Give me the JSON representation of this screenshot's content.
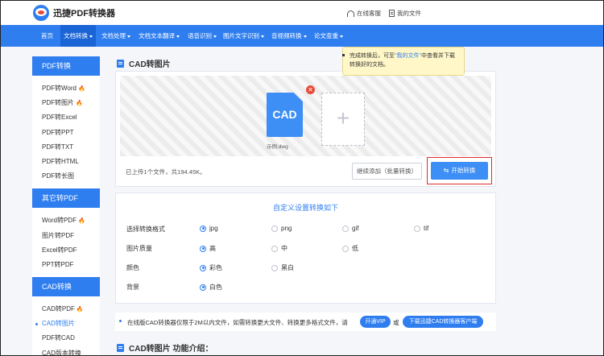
{
  "header": {
    "logo_text": "迅捷PDF转换器",
    "service_label": "在线客服",
    "my_files_label": "我的文件"
  },
  "nav": {
    "items": [
      {
        "label": "首页",
        "dropdown": false
      },
      {
        "label": "文档转换",
        "dropdown": true,
        "active": true
      },
      {
        "label": "文档处理",
        "dropdown": true
      },
      {
        "label": "文档文本翻译",
        "dropdown": true
      },
      {
        "label": "语音识别",
        "dropdown": true
      },
      {
        "label": "图片文字识别",
        "dropdown": true
      },
      {
        "label": "音视频转换",
        "dropdown": true
      },
      {
        "label": "论文查重",
        "dropdown": true
      }
    ]
  },
  "tooltip": {
    "part1": "完成转换后，可至",
    "link": "\"我的文件\"",
    "part2": "中查看并下载转换好的文档。"
  },
  "sidebar": {
    "groups": [
      {
        "title": "PDF转换",
        "items": [
          {
            "label": "PDF转Word",
            "hot": true
          },
          {
            "label": "PDF转图片",
            "hot": true
          },
          {
            "label": "PDF转Excel"
          },
          {
            "label": "PDF转PPT"
          },
          {
            "label": "PDF转TXT"
          },
          {
            "label": "PDF转HTML"
          },
          {
            "label": "PDF转长图"
          }
        ]
      },
      {
        "title": "其它转PDF",
        "items": [
          {
            "label": "Word转PDF",
            "hot": true
          },
          {
            "label": "图片转PDF"
          },
          {
            "label": "Excel转PDF"
          },
          {
            "label": "PPT转PDF"
          }
        ]
      },
      {
        "title": "CAD转换",
        "items": [
          {
            "label": "CAD转PDF",
            "hot": true
          },
          {
            "label": "CAD转图片",
            "active": true
          },
          {
            "label": "PDF转CAD"
          },
          {
            "label": "CAD版本转换"
          }
        ]
      }
    ]
  },
  "main": {
    "page_title": "CAD转图片",
    "file": {
      "thumb_text": "CAD",
      "name": "示例.dwg",
      "remove_glyph": "✕"
    },
    "add_glyph": "+",
    "upload_status": "已上传1个文件，共194.45K。",
    "continue_button": "继续添加（批量转换）",
    "start_button": "开始转换",
    "start_glyph": "⇆"
  },
  "settings": {
    "title": "自定义设置转换如下",
    "rows": [
      {
        "label": "选择转换格式",
        "options": [
          {
            "label": "jpg",
            "selected": true
          },
          {
            "label": "png"
          },
          {
            "label": "gif"
          },
          {
            "label": "tif"
          }
        ]
      },
      {
        "label": "图片质量",
        "options": [
          {
            "label": "高",
            "selected": true
          },
          {
            "label": "中"
          },
          {
            "label": "低"
          }
        ]
      },
      {
        "label": "颜色",
        "options": [
          {
            "label": "彩色",
            "selected": true
          },
          {
            "label": "黑白"
          }
        ]
      },
      {
        "label": "背景",
        "options": [
          {
            "label": "白色",
            "selected": true
          }
        ]
      }
    ]
  },
  "notice": {
    "message": "在线版CAD转换器仅限于2M以内文件，如需转换更大文件、转换更多格式文件，请",
    "vip_button": "开通VIP",
    "or_text": "或",
    "download_button": "下载迅捷CAD转换器客户端"
  },
  "intro": {
    "title": "CAD转图片 功能介绍："
  },
  "colors": {
    "primary": "#2f7ef0",
    "highlight_border": "#e02a2a",
    "hot": "#ff6a1a",
    "tooltip_bg": "#fff7c8"
  }
}
